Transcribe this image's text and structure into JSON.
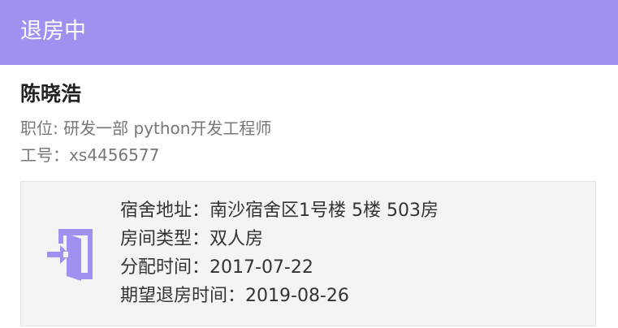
{
  "header": {
    "title": "退房中"
  },
  "employee": {
    "name": "陈晓浩",
    "position_label": "职位:",
    "position_value": "研发一部 python开发工程师",
    "id_label": "工号：",
    "id_value": "xs4456577"
  },
  "details": {
    "address_label": "宿舍地址：",
    "address_value": "南沙宿舍区1号楼 5楼 503房",
    "room_type_label": "房间类型：",
    "room_type_value": "双人房",
    "assign_label": "分配时间：",
    "assign_value": "2017-07-22",
    "checkout_label": "期望退房时间：",
    "checkout_value": "2019-08-26"
  },
  "icon": {
    "name": "checkout-door-icon",
    "color": "#9e92f0"
  },
  "colors": {
    "header_bg": "#9e92f0",
    "card_bg": "#f4f4f4"
  }
}
